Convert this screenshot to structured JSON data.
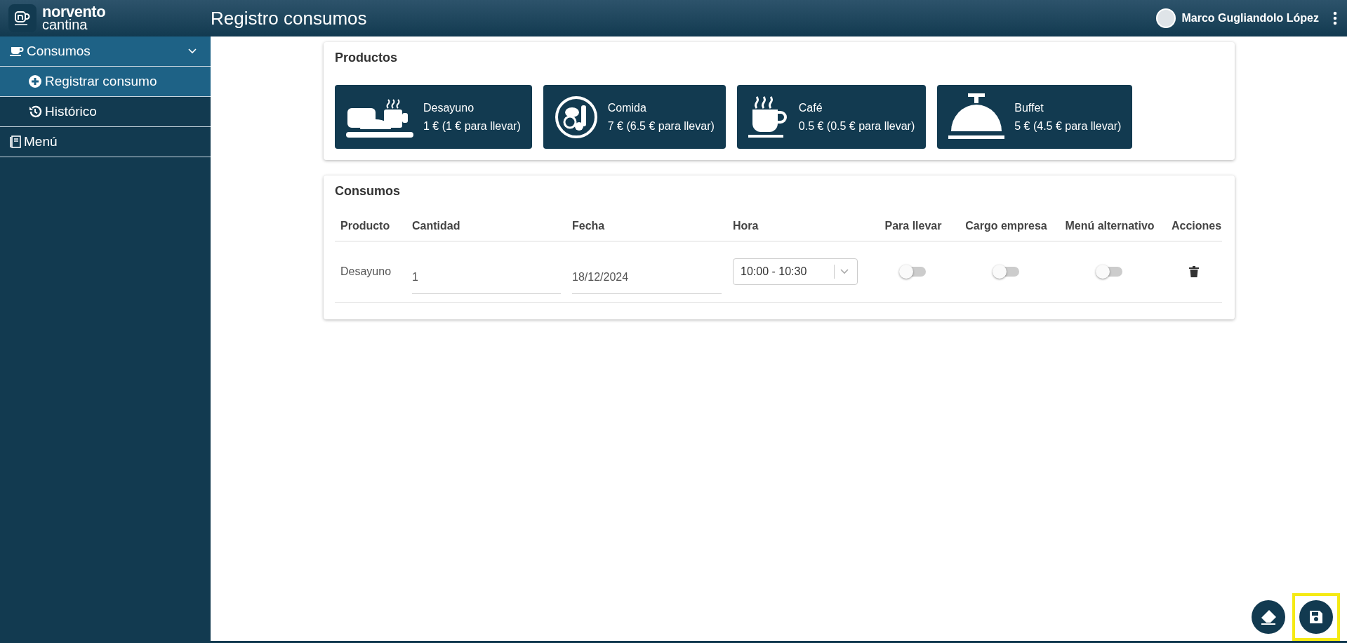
{
  "app": {
    "brand_name": "norvento",
    "brand_sub": "cantina",
    "title": "Registro consumos"
  },
  "user": {
    "name": "Marco Gugliandolo López"
  },
  "sidebar": {
    "items": [
      {
        "label": "Consumos",
        "kind": "cup",
        "expanded": true,
        "children": [
          {
            "label": "Registrar consumo",
            "kind": "plus",
            "selected": true
          },
          {
            "label": "Histórico",
            "kind": "history",
            "selected": false
          }
        ]
      },
      {
        "label": "Menú",
        "kind": "book",
        "expanded": false
      }
    ]
  },
  "products": {
    "title": "Productos",
    "items": [
      {
        "kind": "breakfast",
        "name": "Desayuno",
        "price": "1 € (1 € para llevar)"
      },
      {
        "kind": "meal",
        "name": "Comida",
        "price": "7 € (6.5 € para llevar)"
      },
      {
        "kind": "coffee",
        "name": "Café",
        "price": "0.5 € (0.5 € para llevar)"
      },
      {
        "kind": "buffet",
        "name": "Buffet",
        "price": "5 € (4.5 € para llevar)"
      }
    ]
  },
  "consumos": {
    "title": "Consumos",
    "columns": [
      "Producto",
      "Cantidad",
      "Fecha",
      "Hora",
      "Para llevar",
      "Cargo empresa",
      "Menú alternativo",
      "Acciones"
    ],
    "rows": [
      {
        "producto": "Desayuno",
        "cantidad": "1",
        "fecha": "18/12/2024",
        "hora": "10:00 - 10:30",
        "para_llevar": false,
        "cargo_empresa": false,
        "menu_alternativo": false
      }
    ]
  },
  "fab": [
    {
      "kind": "clear",
      "highlighted": false
    },
    {
      "kind": "save",
      "highlighted": true
    }
  ]
}
